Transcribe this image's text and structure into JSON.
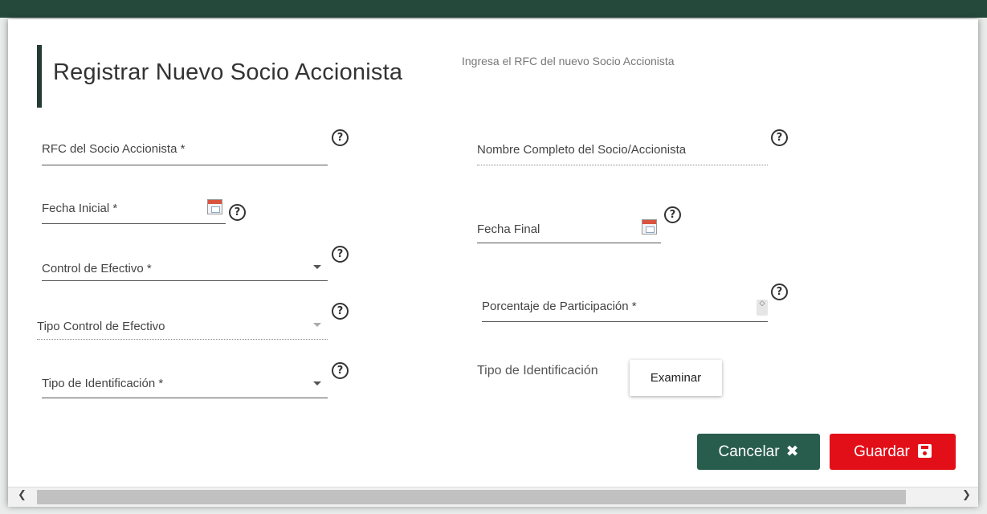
{
  "modal": {
    "title": "Registrar Nuevo Socio Accionista",
    "subtitle": "Ingresa el RFC del nuevo Socio Accionista"
  },
  "fields": {
    "rfc_label": "RFC del Socio Accionista *",
    "nombre_label": "Nombre Completo del Socio/Accionista",
    "fecha_inicial_label": "Fecha Inicial *",
    "fecha_final_label": "Fecha Final",
    "control_efectivo_label": "Control de Efectivo *",
    "porcentaje_label": "Porcentaje de Participación *",
    "tipo_control_label": "Tipo Control de Efectivo",
    "tipo_identificacion_label": "Tipo de Identificación *",
    "tipo_identificacion_file_label": "Tipo de Identificación"
  },
  "icons": {
    "help": "?",
    "spin": "◇",
    "close": "✖",
    "scroll_left": "❮",
    "scroll_right": "❯"
  },
  "buttons": {
    "examinar": "Examinar",
    "cancelar": "Cancelar",
    "guardar": "Guardar"
  },
  "colors": {
    "cancel": "#285c4d",
    "save": "#e30f18",
    "header": "#254a3c"
  }
}
